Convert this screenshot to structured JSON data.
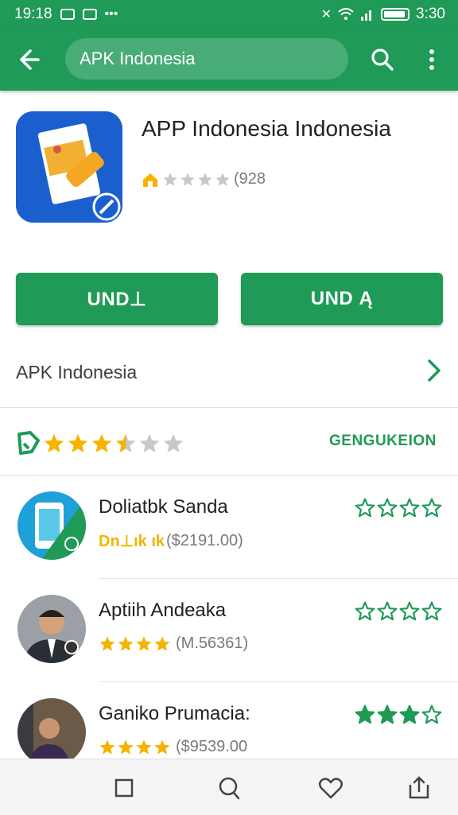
{
  "status_bar": {
    "time_left": "19:18",
    "time_right": "3:30"
  },
  "top_bar": {
    "search_value": "APK Indonesia"
  },
  "app": {
    "title": "APP Indonesia Indonesia",
    "review_count": "(928",
    "rating_stars": 1
  },
  "buttons": {
    "primary_label": "UND⊥",
    "secondary_label": "UND Ą"
  },
  "developer": {
    "label": "APK Indonesia"
  },
  "similar": {
    "rating_stars": 3.5,
    "link_label": "GENGUKEION"
  },
  "list": [
    {
      "title": "Doliatbk Sanda",
      "sub_text": "Dn⊥ık ık",
      "price": "($2191.00)",
      "right_stars": 4,
      "right_filled": 0
    },
    {
      "title": "Aptiih Andeaka",
      "sub_text": "",
      "price": "(M.56361)",
      "right_stars": 4,
      "right_filled": 0
    },
    {
      "title": "Ganiko Prumacia:",
      "sub_text": "",
      "price": "($9539.00",
      "right_stars": 4,
      "right_filled": 3
    }
  ],
  "colors": {
    "accent": "#1f9a57",
    "star_gold": "#f4b400",
    "star_grey": "#c8c8c8",
    "app_icon_blue": "#1b5fcf"
  },
  "icons": {
    "back": "arrow-left-icon",
    "search": "search-icon",
    "more": "more-vertical-icon",
    "chevron": "chevron-right-icon",
    "nav_home": "square-icon",
    "nav_search": "search-icon",
    "nav_favorite": "heart-icon",
    "nav_share": "share-icon"
  }
}
